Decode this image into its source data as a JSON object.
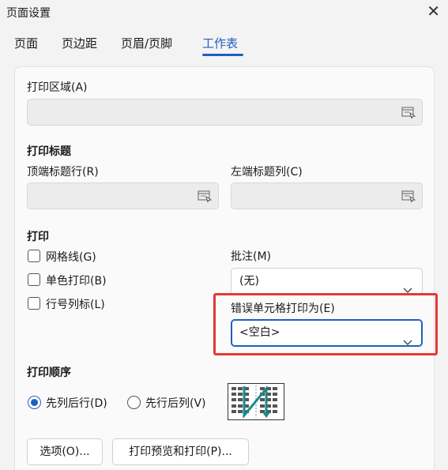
{
  "window": {
    "title": "页面设置",
    "close_glyph": "✕"
  },
  "tabs": [
    {
      "label": "页面"
    },
    {
      "label": "页边距"
    },
    {
      "label": "页眉/页脚"
    },
    {
      "label": "工作表",
      "active": true
    }
  ],
  "print_area": {
    "label": "打印区域(A)",
    "value": ""
  },
  "print_titles": {
    "heading": "打印标题",
    "top_rows_label": "顶端标题行(R)",
    "left_cols_label": "左端标题列(C)"
  },
  "print": {
    "heading": "打印",
    "gridlines": {
      "label": "网格线(G)",
      "checked": false
    },
    "mono": {
      "label": "单色打印(B)",
      "checked": false
    },
    "headings": {
      "label": "行号列标(L)",
      "checked": false
    },
    "comments_label": "批注(M)",
    "comments_value": "(无)",
    "errors_label": "错误单元格打印为(E)",
    "errors_value": "<空白>"
  },
  "order": {
    "heading": "打印顺序",
    "down_then_over": {
      "label": "先列后行(D)",
      "checked": true
    },
    "over_then_down": {
      "label": "先行后列(V)",
      "checked": false
    }
  },
  "buttons": {
    "options": "选项(O)...",
    "preview_print": "打印预览和打印(P)..."
  },
  "colors": {
    "accent": "#1f5fbf",
    "highlight": "#e53935",
    "order_arrow": "#1a8a8a"
  }
}
